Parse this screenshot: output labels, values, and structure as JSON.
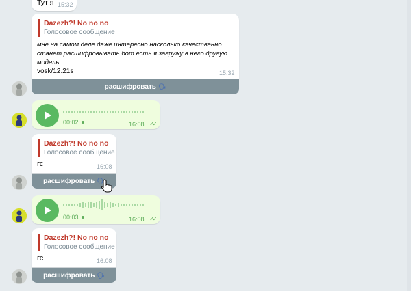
{
  "top_message": {
    "text": "Тут я",
    "time": "15:32"
  },
  "long_message": {
    "quote_name": "Dazezh?! No no no",
    "quote_sub": "Голосовое сообщение",
    "line1": "мне на самом деле даже интересно насколько качественно",
    "line2": "станет расшифровывать бот есть я загружу в него другую",
    "line3": "модель",
    "line4": "vosk/12.21s",
    "time": "15:32",
    "button": "расшифровать",
    "button_emoji": "🗣"
  },
  "voice1": {
    "duration": "00:02",
    "time": "16:08",
    "ticks": "✓✓"
  },
  "reply1": {
    "quote_name": "Dazezh?! No no no",
    "quote_sub": "Голосовое сообщение",
    "text": "гс",
    "time": "16:08",
    "button": "расшифровать",
    "button_emoji": "🗣"
  },
  "voice2": {
    "duration": "00:03",
    "time": "16:08",
    "ticks": "✓✓"
  },
  "reply2": {
    "quote_name": "Dazezh?! No no no",
    "quote_sub": "Голосовое сообщение",
    "text": "гс",
    "time": "16:08",
    "button": "расшифровать",
    "button_emoji": "🗣"
  },
  "colors": {
    "chat_bg": "#e6ebee",
    "outgoing": "#effdde",
    "accent_green": "#5ab961",
    "quote_red": "#c0392b",
    "button_bg": "#7f9199"
  },
  "icons": [
    "play-icon",
    "waveform-icon",
    "double-check-icon",
    "speaking-head-icon",
    "cursor-hand-icon",
    "bot-avatar",
    "user-avatar"
  ]
}
